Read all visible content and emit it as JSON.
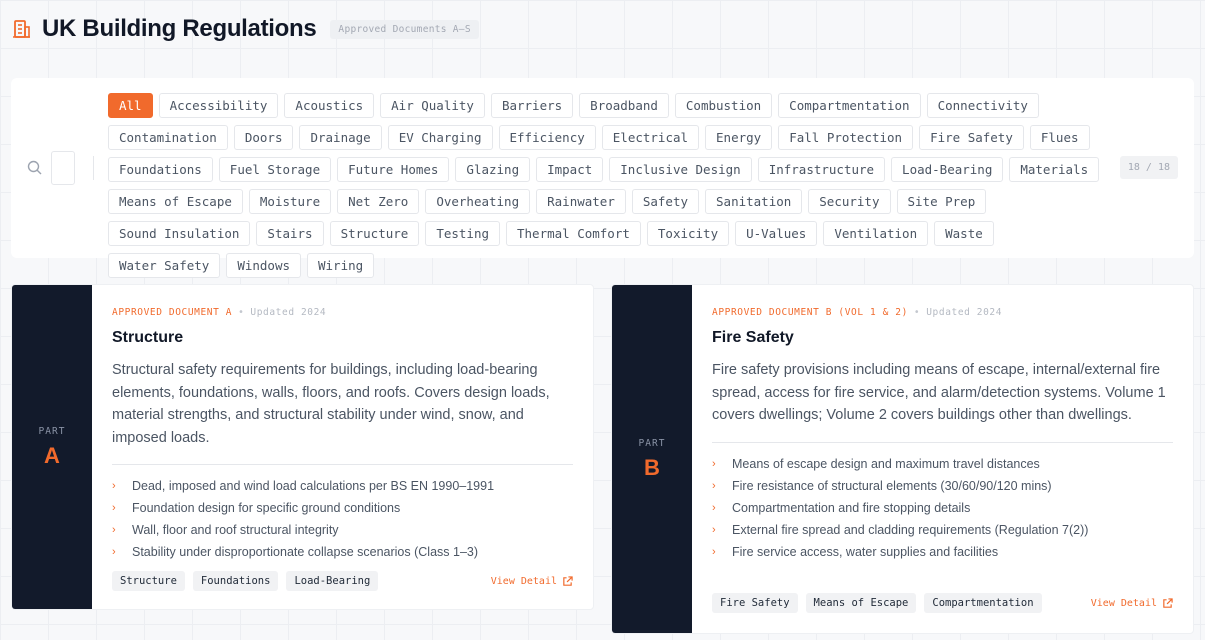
{
  "header": {
    "title": "UK Building Regulations",
    "subtitle_badge": "Approved Documents A–S"
  },
  "filters": {
    "tags": [
      "All",
      "Accessibility",
      "Acoustics",
      "Air Quality",
      "Barriers",
      "Broadband",
      "Combustion",
      "Compartmentation",
      "Connectivity",
      "Contamination",
      "Doors",
      "Drainage",
      "EV Charging",
      "Efficiency",
      "Electrical",
      "Energy",
      "Fall Protection",
      "Fire Safety",
      "Flues",
      "Foundations",
      "Fuel Storage",
      "Future Homes",
      "Glazing",
      "Impact",
      "Inclusive Design",
      "Infrastructure",
      "Load-Bearing",
      "Materials",
      "Means of Escape",
      "Moisture",
      "Net Zero",
      "Overheating",
      "Rainwater",
      "Safety",
      "Sanitation",
      "Security",
      "Site Prep",
      "Sound Insulation",
      "Stairs",
      "Structure",
      "Testing",
      "Thermal Comfort",
      "Toxicity",
      "U-Values",
      "Ventilation",
      "Waste",
      "Water Safety",
      "Windows",
      "Wiring"
    ],
    "active_tag": "All",
    "count": "18 / 18"
  },
  "cards": [
    {
      "part_label": "PART",
      "part_letter": "A",
      "doc_label": "APPROVED DOCUMENT A",
      "updated": "Updated 2024",
      "title": "Structure",
      "description": "Structural safety requirements for buildings, including load-bearing elements, foundations, walls, floors, and roofs. Covers design loads, material strengths, and structural stability under wind, snow, and imposed loads.",
      "bullets": [
        "Dead, imposed and wind load calculations per BS EN 1990–1991",
        "Foundation design for specific ground conditions",
        "Wall, floor and roof structural integrity",
        "Stability under disproportionate collapse scenarios (Class 1–3)"
      ],
      "chips": [
        "Structure",
        "Foundations",
        "Load-Bearing"
      ],
      "view_label": "View Detail"
    },
    {
      "part_label": "PART",
      "part_letter": "B",
      "doc_label": "APPROVED DOCUMENT B (VOL 1 & 2)",
      "updated": "Updated 2024",
      "title": "Fire Safety",
      "description": "Fire safety provisions including means of escape, internal/external fire spread, access for fire service, and alarm/detection systems. Volume 1 covers dwellings; Volume 2 covers buildings other than dwellings.",
      "bullets": [
        "Means of escape design and maximum travel distances",
        "Fire resistance of structural elements (30/60/90/120 mins)",
        "Compartmentation and fire stopping details",
        "External fire spread and cladding requirements (Regulation 7(2))",
        "Fire service access, water supplies and facilities"
      ],
      "chips": [
        "Fire Safety",
        "Means of Escape",
        "Compartmentation"
      ],
      "view_label": "View Detail"
    }
  ],
  "colors": {
    "accent": "#f16a2c",
    "strip": "#121a2b"
  }
}
